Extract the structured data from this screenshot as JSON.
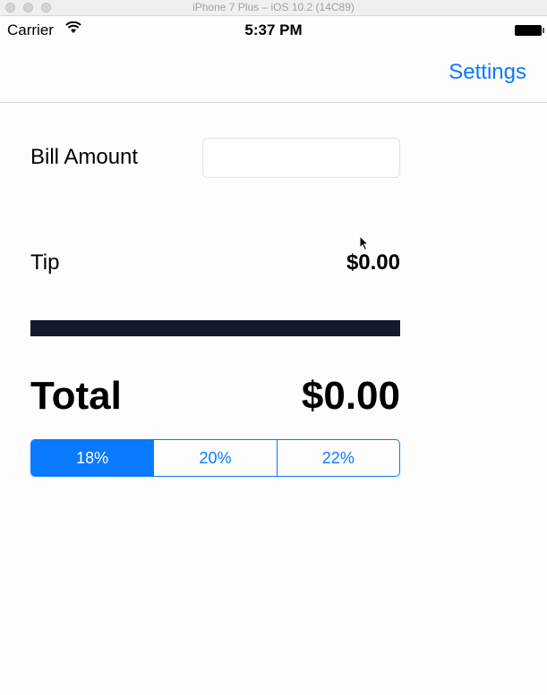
{
  "window": {
    "title": "iPhone 7 Plus – iOS 10.2 (14C89)"
  },
  "status_bar": {
    "carrier": "Carrier",
    "time": "5:37 PM"
  },
  "nav": {
    "settings_label": "Settings"
  },
  "form": {
    "bill_label": "Bill Amount",
    "bill_value": "",
    "bill_placeholder": "",
    "tip_label": "Tip",
    "tip_value": "$0.00",
    "total_label": "Total",
    "total_value": "$0.00"
  },
  "tip_options": {
    "items": [
      "18%",
      "20%",
      "22%"
    ],
    "selected": "18%"
  },
  "colors": {
    "accent": "#0a7aff",
    "divider_bar": "#111a2e"
  }
}
